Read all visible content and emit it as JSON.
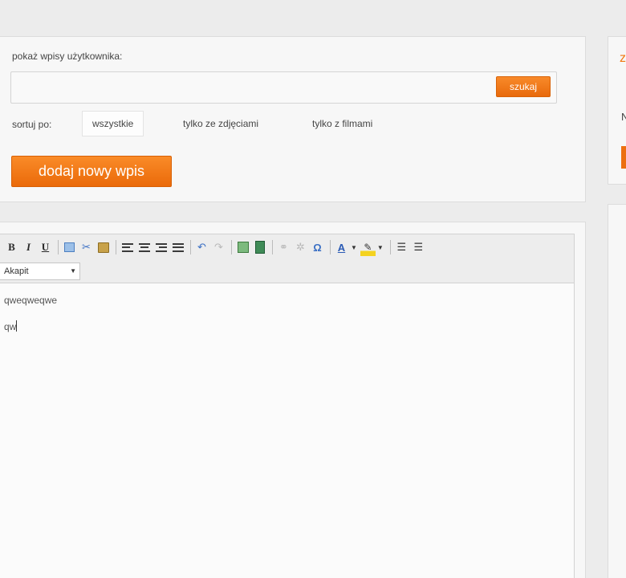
{
  "search": {
    "label": "pokaż wpisy użytkownika:",
    "value": "",
    "button_label": "szukaj"
  },
  "sort": {
    "label": "sortuj po:",
    "options": [
      {
        "label": "wszystkie",
        "active": true
      },
      {
        "label": "tylko ze zdjęciami",
        "active": false
      },
      {
        "label": "tylko z filmami",
        "active": false
      }
    ]
  },
  "add_entry": {
    "button_label": "dodaj nowy wpis"
  },
  "editor": {
    "toolbar": {
      "bold": "B",
      "italic": "I",
      "underline": "U",
      "special_char": "Ω",
      "font_color": "A"
    },
    "format_select": {
      "selected": "Akapit"
    },
    "lines": [
      "qweqweqwe",
      "qw"
    ]
  },
  "sidebar": {
    "orange_text": "z",
    "dark_text": "N"
  },
  "colors": {
    "accent_orange": "#f07810",
    "background": "#ececec",
    "panel": "#f7f7f7"
  }
}
